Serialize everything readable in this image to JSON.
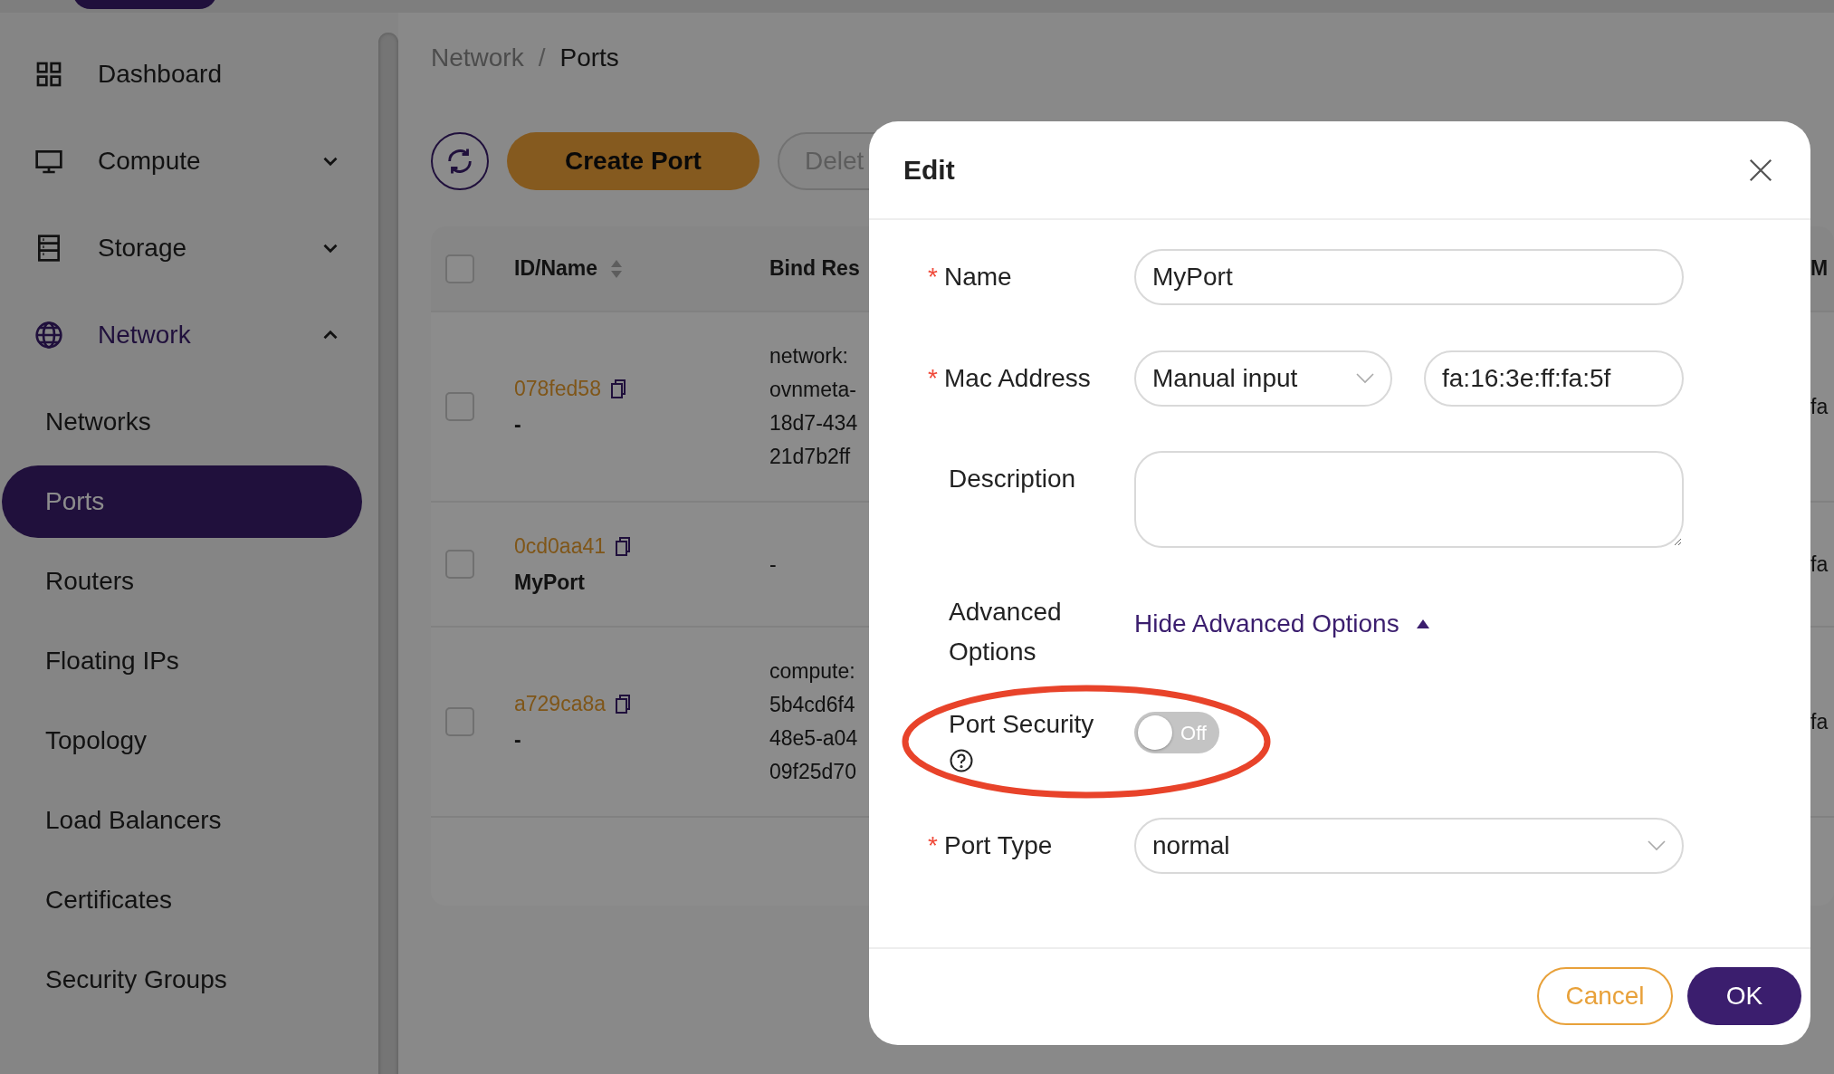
{
  "sidebar": {
    "items": [
      {
        "label": "Dashboard",
        "selected": false
      },
      {
        "label": "Compute",
        "selected": false,
        "expanded": false
      },
      {
        "label": "Storage",
        "selected": false,
        "expanded": false
      },
      {
        "label": "Network",
        "selected": true,
        "expanded": true,
        "children": [
          {
            "label": "Networks",
            "selected": false
          },
          {
            "label": "Ports",
            "selected": true
          },
          {
            "label": "Routers",
            "selected": false
          },
          {
            "label": "Floating IPs",
            "selected": false
          },
          {
            "label": "Topology",
            "selected": false
          },
          {
            "label": "Load Balancers",
            "selected": false
          },
          {
            "label": "Certificates",
            "selected": false
          },
          {
            "label": "Security Groups",
            "selected": false
          }
        ]
      }
    ]
  },
  "breadcrumb": {
    "separator": "/",
    "items": [
      {
        "label": "Network",
        "selected": false
      },
      {
        "label": "Ports",
        "selected": true
      }
    ]
  },
  "toolbar": [
    {
      "kind": "refresh",
      "disabled": false
    },
    {
      "kind": "primary",
      "label": "Create Port",
      "disabled": false
    },
    {
      "kind": "default",
      "label": "Delet",
      "disabled": true
    }
  ],
  "table": {
    "all_checked": false,
    "columns": [
      {
        "label": "ID/Name",
        "sortable": true
      },
      {
        "label": "Bind Res",
        "sortable": false
      },
      {
        "label": "M",
        "sortable": false
      }
    ],
    "rows": [
      {
        "checked": false,
        "id": "078fed58",
        "name": "-",
        "bind": [
          "network:",
          "ovnmeta-",
          "18d7-434",
          "21d7b2ff"
        ],
        "column_3": "fa"
      },
      {
        "checked": false,
        "id": "0cd0aa41",
        "name": "MyPort",
        "bind": [
          "-"
        ],
        "column_3": "fa"
      },
      {
        "checked": false,
        "id": "a729ca8a",
        "name": "-",
        "bind": [
          "compute:",
          "5b4cd6f4",
          "48e5-a04",
          "09f25d70"
        ],
        "column_3": "fa"
      }
    ]
  },
  "dialog": {
    "title": "Edit",
    "fields": [
      {
        "kind": "text",
        "required_mark": "*",
        "label": "Name",
        "value": "MyPort"
      },
      {
        "kind": "mac",
        "required_mark": "*",
        "label": "Mac Address",
        "mode": "Manual input",
        "value": "fa:16:3e:ff:fa:5f"
      },
      {
        "kind": "textarea",
        "label": "Description"
      },
      {
        "kind": "link",
        "label": "Advanced Options",
        "link": "Hide Advanced Options",
        "expanded": true
      },
      {
        "kind": "switch",
        "label": "Port Security",
        "on": false,
        "switch_text": "Off",
        "help": true,
        "highlighted": true
      },
      {
        "kind": "select",
        "required_mark": "*",
        "label": "Port Type",
        "value": "normal"
      }
    ],
    "buttons": [
      {
        "kind": "cancel",
        "label": "Cancel"
      },
      {
        "kind": "ok",
        "label": "OK"
      }
    ]
  }
}
